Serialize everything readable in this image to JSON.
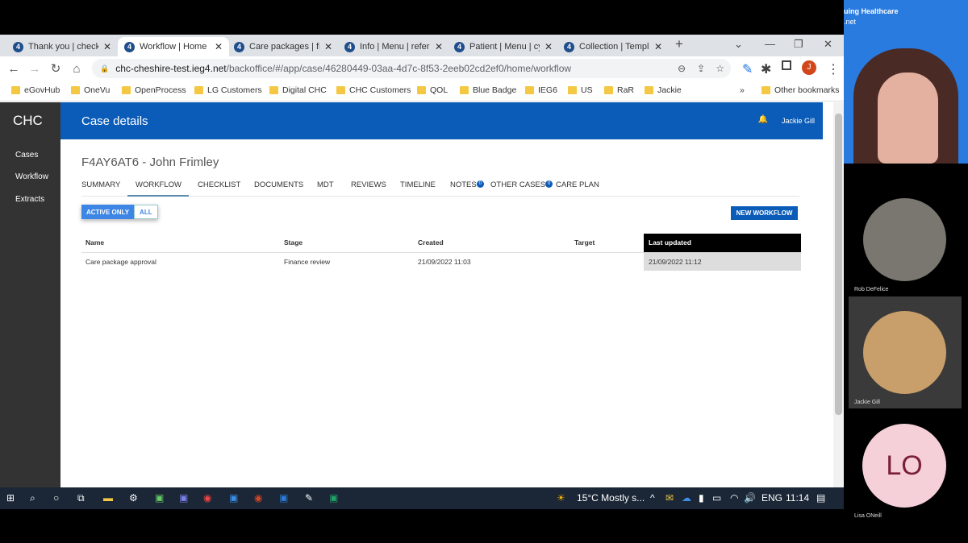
{
  "browser": {
    "tabs": [
      {
        "title": "Thank you | checkli",
        "active": false
      },
      {
        "title": "Workflow | Home |",
        "active": true
      },
      {
        "title": "Care packages | fin",
        "active": false
      },
      {
        "title": "Info | Menu | referr",
        "active": false
      },
      {
        "title": "Patient | Menu | cy",
        "active": false
      },
      {
        "title": "Collection | Templa",
        "active": false
      }
    ],
    "favicon": "4",
    "url_host": "chc-cheshire-test.ieg4.net",
    "url_path": "/backoffice/#/app/case/46280449-03aa-4d7c-8f53-2eeb02cd2ef0/home/workflow",
    "profile_initial": "J",
    "bookmarks": [
      "eGovHub",
      "OneVu",
      "OpenProcess",
      "LG Customers",
      "Digital CHC",
      "CHC Customers",
      "QOL",
      "Blue Badge",
      "IEG6",
      "US",
      "RaR",
      "Jackie"
    ],
    "other_bookmarks": "Other bookmarks"
  },
  "app": {
    "logo": "CHC",
    "sidebar": [
      "Cases",
      "Workflow",
      "Extracts"
    ],
    "header_title": "Case details",
    "user": "Jackie Gill",
    "case_title": "F4AY6AT6 - John Frimley",
    "tabs": [
      {
        "label": "SUMMARY"
      },
      {
        "label": "WORKFLOW",
        "active": true
      },
      {
        "label": "CHECKLIST"
      },
      {
        "label": "DOCUMENTS"
      },
      {
        "label": "MDT"
      },
      {
        "label": "REVIEWS"
      },
      {
        "label": "TIMELINE"
      },
      {
        "label": "NOTES",
        "badge": "0"
      },
      {
        "label": "OTHER CASES",
        "badge": "0"
      },
      {
        "label": "CARE PLAN"
      }
    ],
    "filter": {
      "active_only": "ACTIVE ONLY",
      "all": "ALL",
      "selected": "ACTIVE ONLY"
    },
    "new_workflow": "NEW WORKFLOW",
    "table": {
      "headers": [
        "Name",
        "Stage",
        "Created",
        "Target",
        "Last updated"
      ],
      "rows": [
        [
          "Care package approval",
          "Finance review",
          "21/09/2022 11:03",
          "",
          "21/09/2022 11:12"
        ]
      ]
    }
  },
  "taskbar": {
    "weather": "15°C  Mostly s...",
    "lang": "ENG",
    "time": "11:14"
  },
  "meeting": {
    "banner": "uing Healthcare",
    "banner2": ".net",
    "participants": [
      {
        "name": "Rob DeFelice"
      },
      {
        "name": "Jackie Gill"
      },
      {
        "name": "Lisa ONeill",
        "initials": "LO"
      }
    ]
  },
  "colors": {
    "brand": "#0b5cb8",
    "sidebar": "#333333",
    "last_updated_header": "#000000"
  }
}
